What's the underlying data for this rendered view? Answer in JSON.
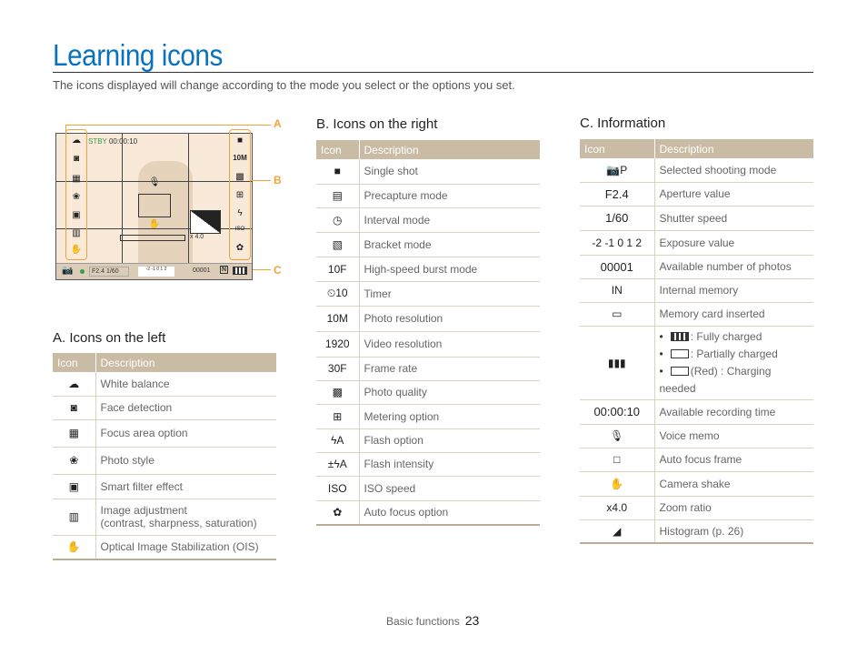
{
  "page": {
    "title": "Learning icons",
    "subtitle": "The icons displayed will change according to the mode you select or the options you set.",
    "footer_section": "Basic functions",
    "page_number": "23"
  },
  "screen": {
    "status": "STBY",
    "time": "00:00:10",
    "aperture": "F2.4",
    "shutter": "1/60",
    "zoom": "x 4.0",
    "count": "00001",
    "callouts": [
      "A",
      "B",
      "C"
    ],
    "accent_color": "#f0a33a"
  },
  "left": {
    "title": "A. Icons on the left",
    "headers": [
      "Icon",
      "Description"
    ],
    "rows": [
      {
        "icon": "white-balance-icon",
        "glyph": "☁",
        "desc": "White balance"
      },
      {
        "icon": "face-detection-icon",
        "glyph": "◙",
        "desc": "Face detection"
      },
      {
        "icon": "focus-area-icon",
        "glyph": "▦",
        "desc": "Focus area option"
      },
      {
        "icon": "photo-style-icon",
        "glyph": "❀",
        "desc": "Photo style"
      },
      {
        "icon": "smart-filter-icon",
        "glyph": "▣",
        "desc": "Smart filter effect"
      },
      {
        "icon": "image-adjust-icon",
        "glyph": "▥",
        "desc": "Image adjustment",
        "desc2": "(contrast, sharpness, saturation)"
      },
      {
        "icon": "ois-icon",
        "glyph": "✋",
        "desc": "Optical Image Stabilization (OIS)"
      }
    ]
  },
  "right": {
    "title": "B. Icons on the right",
    "headers": [
      "Icon",
      "Description"
    ],
    "rows": [
      {
        "icon": "single-shot-icon",
        "glyph": "■",
        "desc": "Single shot"
      },
      {
        "icon": "precapture-icon",
        "glyph": "▤",
        "desc": "Precapture mode"
      },
      {
        "icon": "interval-icon",
        "glyph": "◷",
        "desc": "Interval mode"
      },
      {
        "icon": "bracket-icon",
        "glyph": "▧",
        "desc": "Bracket mode"
      },
      {
        "icon": "burst-icon",
        "glyph": "10F",
        "desc": "High-speed burst mode"
      },
      {
        "icon": "timer-icon",
        "glyph": "⏲10",
        "desc": "Timer"
      },
      {
        "icon": "photo-resolution-icon",
        "glyph": "10M",
        "desc": "Photo resolution"
      },
      {
        "icon": "video-resolution-icon",
        "glyph": "1920",
        "desc": "Video resolution"
      },
      {
        "icon": "frame-rate-icon",
        "glyph": "30F",
        "desc": "Frame rate"
      },
      {
        "icon": "photo-quality-icon",
        "glyph": "▩",
        "desc": "Photo quality"
      },
      {
        "icon": "metering-icon",
        "glyph": "⊞",
        "desc": "Metering option"
      },
      {
        "icon": "flash-icon",
        "glyph": "ϟA",
        "desc": "Flash option"
      },
      {
        "icon": "flash-intensity-icon",
        "glyph": "±ϟA",
        "desc": "Flash intensity"
      },
      {
        "icon": "iso-icon",
        "glyph": "ISO",
        "desc": "ISO speed"
      },
      {
        "icon": "af-option-icon",
        "glyph": "✿",
        "desc": "Auto focus option"
      }
    ]
  },
  "info": {
    "title": "C. Information",
    "headers": [
      "Icon",
      "Description"
    ],
    "rows": [
      {
        "icon": "shooting-mode-icon",
        "glyph": "📷P",
        "desc": "Selected shooting mode"
      },
      {
        "icon": "aperture-text",
        "glyph": "F2.4",
        "desc": "Aperture value",
        "text": true
      },
      {
        "icon": "shutter-text",
        "glyph": "1/60",
        "desc": "Shutter speed",
        "text": true
      },
      {
        "icon": "exposure-icon",
        "glyph": "-2 -1 0 1 2",
        "desc": "Exposure value"
      },
      {
        "icon": "count-text",
        "glyph": "00001",
        "desc": "Available number of photos",
        "text": true
      },
      {
        "icon": "internal-memory-icon",
        "glyph": "IN",
        "desc": "Internal memory"
      },
      {
        "icon": "memory-card-icon",
        "glyph": "▭",
        "desc": "Memory card inserted"
      },
      {
        "icon": "battery-icon",
        "glyph": "▮▮▮",
        "battery": [
          ": Fully charged",
          ": Partially charged",
          "(Red) : Charging needed"
        ]
      },
      {
        "icon": "rec-time-text",
        "glyph": "00:00:10",
        "desc": "Available recording time",
        "text": true
      },
      {
        "icon": "voice-memo-icon",
        "glyph": "🎙",
        "desc": "Voice memo"
      },
      {
        "icon": "af-frame-icon",
        "glyph": "□",
        "desc": "Auto focus frame"
      },
      {
        "icon": "camera-shake-icon",
        "glyph": "✋",
        "desc": "Camera shake"
      },
      {
        "icon": "zoom-ratio-icon",
        "glyph": "x4.0",
        "desc": "Zoom ratio"
      },
      {
        "icon": "histogram-icon",
        "glyph": "◢",
        "desc": "Histogram (p. 26)"
      }
    ]
  }
}
